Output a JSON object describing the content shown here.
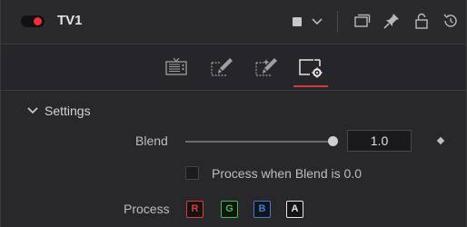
{
  "header": {
    "tool_name": "TV1",
    "enabled": true,
    "colors": {
      "toggle_on": "#e8313a",
      "accent": "#d03a3a"
    },
    "icons": [
      "color-swatch-icon",
      "chevron-down-icon",
      "versions-icon",
      "pin-icon",
      "lock-icon",
      "reset-icon"
    ]
  },
  "tabs": [
    {
      "name": "controls",
      "icon": "tv-icon"
    },
    {
      "name": "scan-lines",
      "icon": "brush-icon"
    },
    {
      "name": "distortion",
      "icon": "brush-sparkle-icon"
    },
    {
      "name": "settings",
      "icon": "settings-gear-icon",
      "active": true
    }
  ],
  "settings": {
    "section_label": "Settings",
    "blend": {
      "label": "Blend",
      "value": "1.0",
      "slider_fraction": 1.0
    },
    "process_when_blend_zero": {
      "label": "Process when Blend is 0.0",
      "checked": false
    },
    "process": {
      "label": "Process",
      "channels": [
        {
          "label": "R",
          "color": "#e03a3a"
        },
        {
          "label": "G",
          "color": "#3cc24a"
        },
        {
          "label": "B",
          "color": "#3f7ae0"
        },
        {
          "label": "A",
          "color": "#e6e6e6"
        }
      ]
    }
  }
}
